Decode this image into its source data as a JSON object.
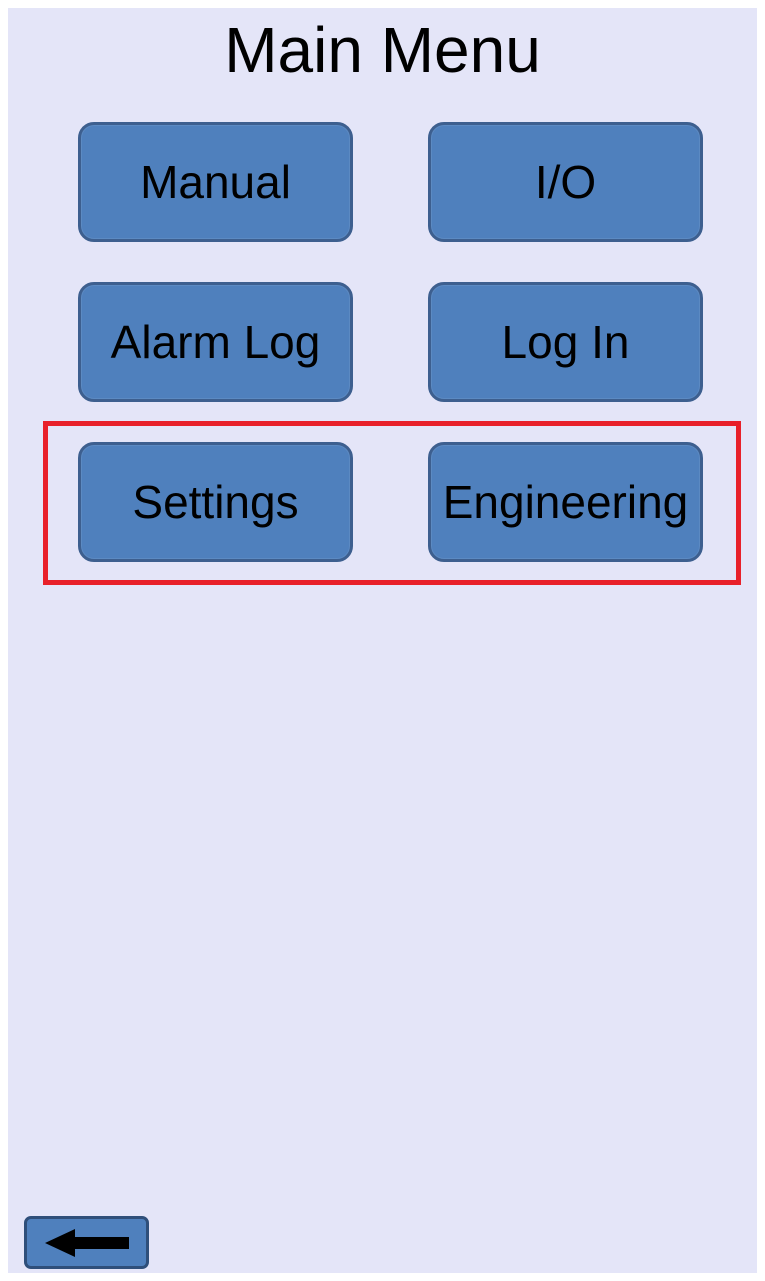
{
  "screen": {
    "title": "Main Menu",
    "background_color": "#e4e5f8",
    "button_color": "#4f80bd"
  },
  "menu": {
    "buttons": [
      {
        "label": "Manual"
      },
      {
        "label": "I/O"
      },
      {
        "label": "Alarm Log"
      },
      {
        "label": "Log In"
      },
      {
        "label": "Settings"
      },
      {
        "label": "Engineering"
      }
    ]
  },
  "highlight": {
    "color": "#e8202a"
  },
  "navigation": {
    "back_icon": "left-arrow-icon"
  }
}
